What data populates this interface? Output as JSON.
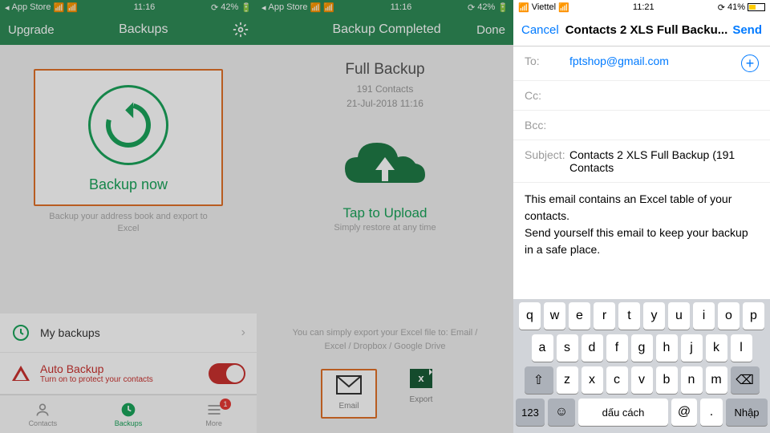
{
  "status": {
    "appstore": "App Store",
    "viettel": "Viettel",
    "time1": "11:16",
    "time3": "11:21",
    "battery1": "42%",
    "battery3": "41%"
  },
  "p1": {
    "upgrade": "Upgrade",
    "title": "Backups",
    "backup_now": "Backup now",
    "subtitle": "Backup your address book and export to Excel",
    "my_backups": "My backups",
    "auto_backup": "Auto Backup",
    "auto_sub": "Turn on to protect your contacts",
    "tab_contacts": "Contacts",
    "tab_backups": "Backups",
    "tab_more": "More",
    "badge": "1"
  },
  "p2": {
    "title": "Backup Completed",
    "done": "Done",
    "full_backup": "Full Backup",
    "contacts": "191 Contacts",
    "date": "21-Jul-2018 11:16",
    "tap": "Tap to Upload",
    "tap_sub": "Simply restore at any time",
    "export_txt": "You can simply export your Excel file to: Email / Excel / Dropbox / Google Drive",
    "email": "Email",
    "export": "Export"
  },
  "p3": {
    "cancel": "Cancel",
    "title": "Contacts 2 XLS Full Backu...",
    "send": "Send",
    "to_lbl": "To:",
    "to_val": "fptshop@gmail.com",
    "cc_lbl": "Cc:",
    "bcc_lbl": "Bcc:",
    "subj_lbl": "Subject:",
    "subj_val": "Contacts 2 XLS Full Backup (191 Contacts",
    "body": "This email contains an Excel table of your contacts.\nSend yourself this email to keep your backup in a safe place.",
    "k_space": "dấu cách",
    "k_enter": "Nhập",
    "k_123": "123"
  }
}
